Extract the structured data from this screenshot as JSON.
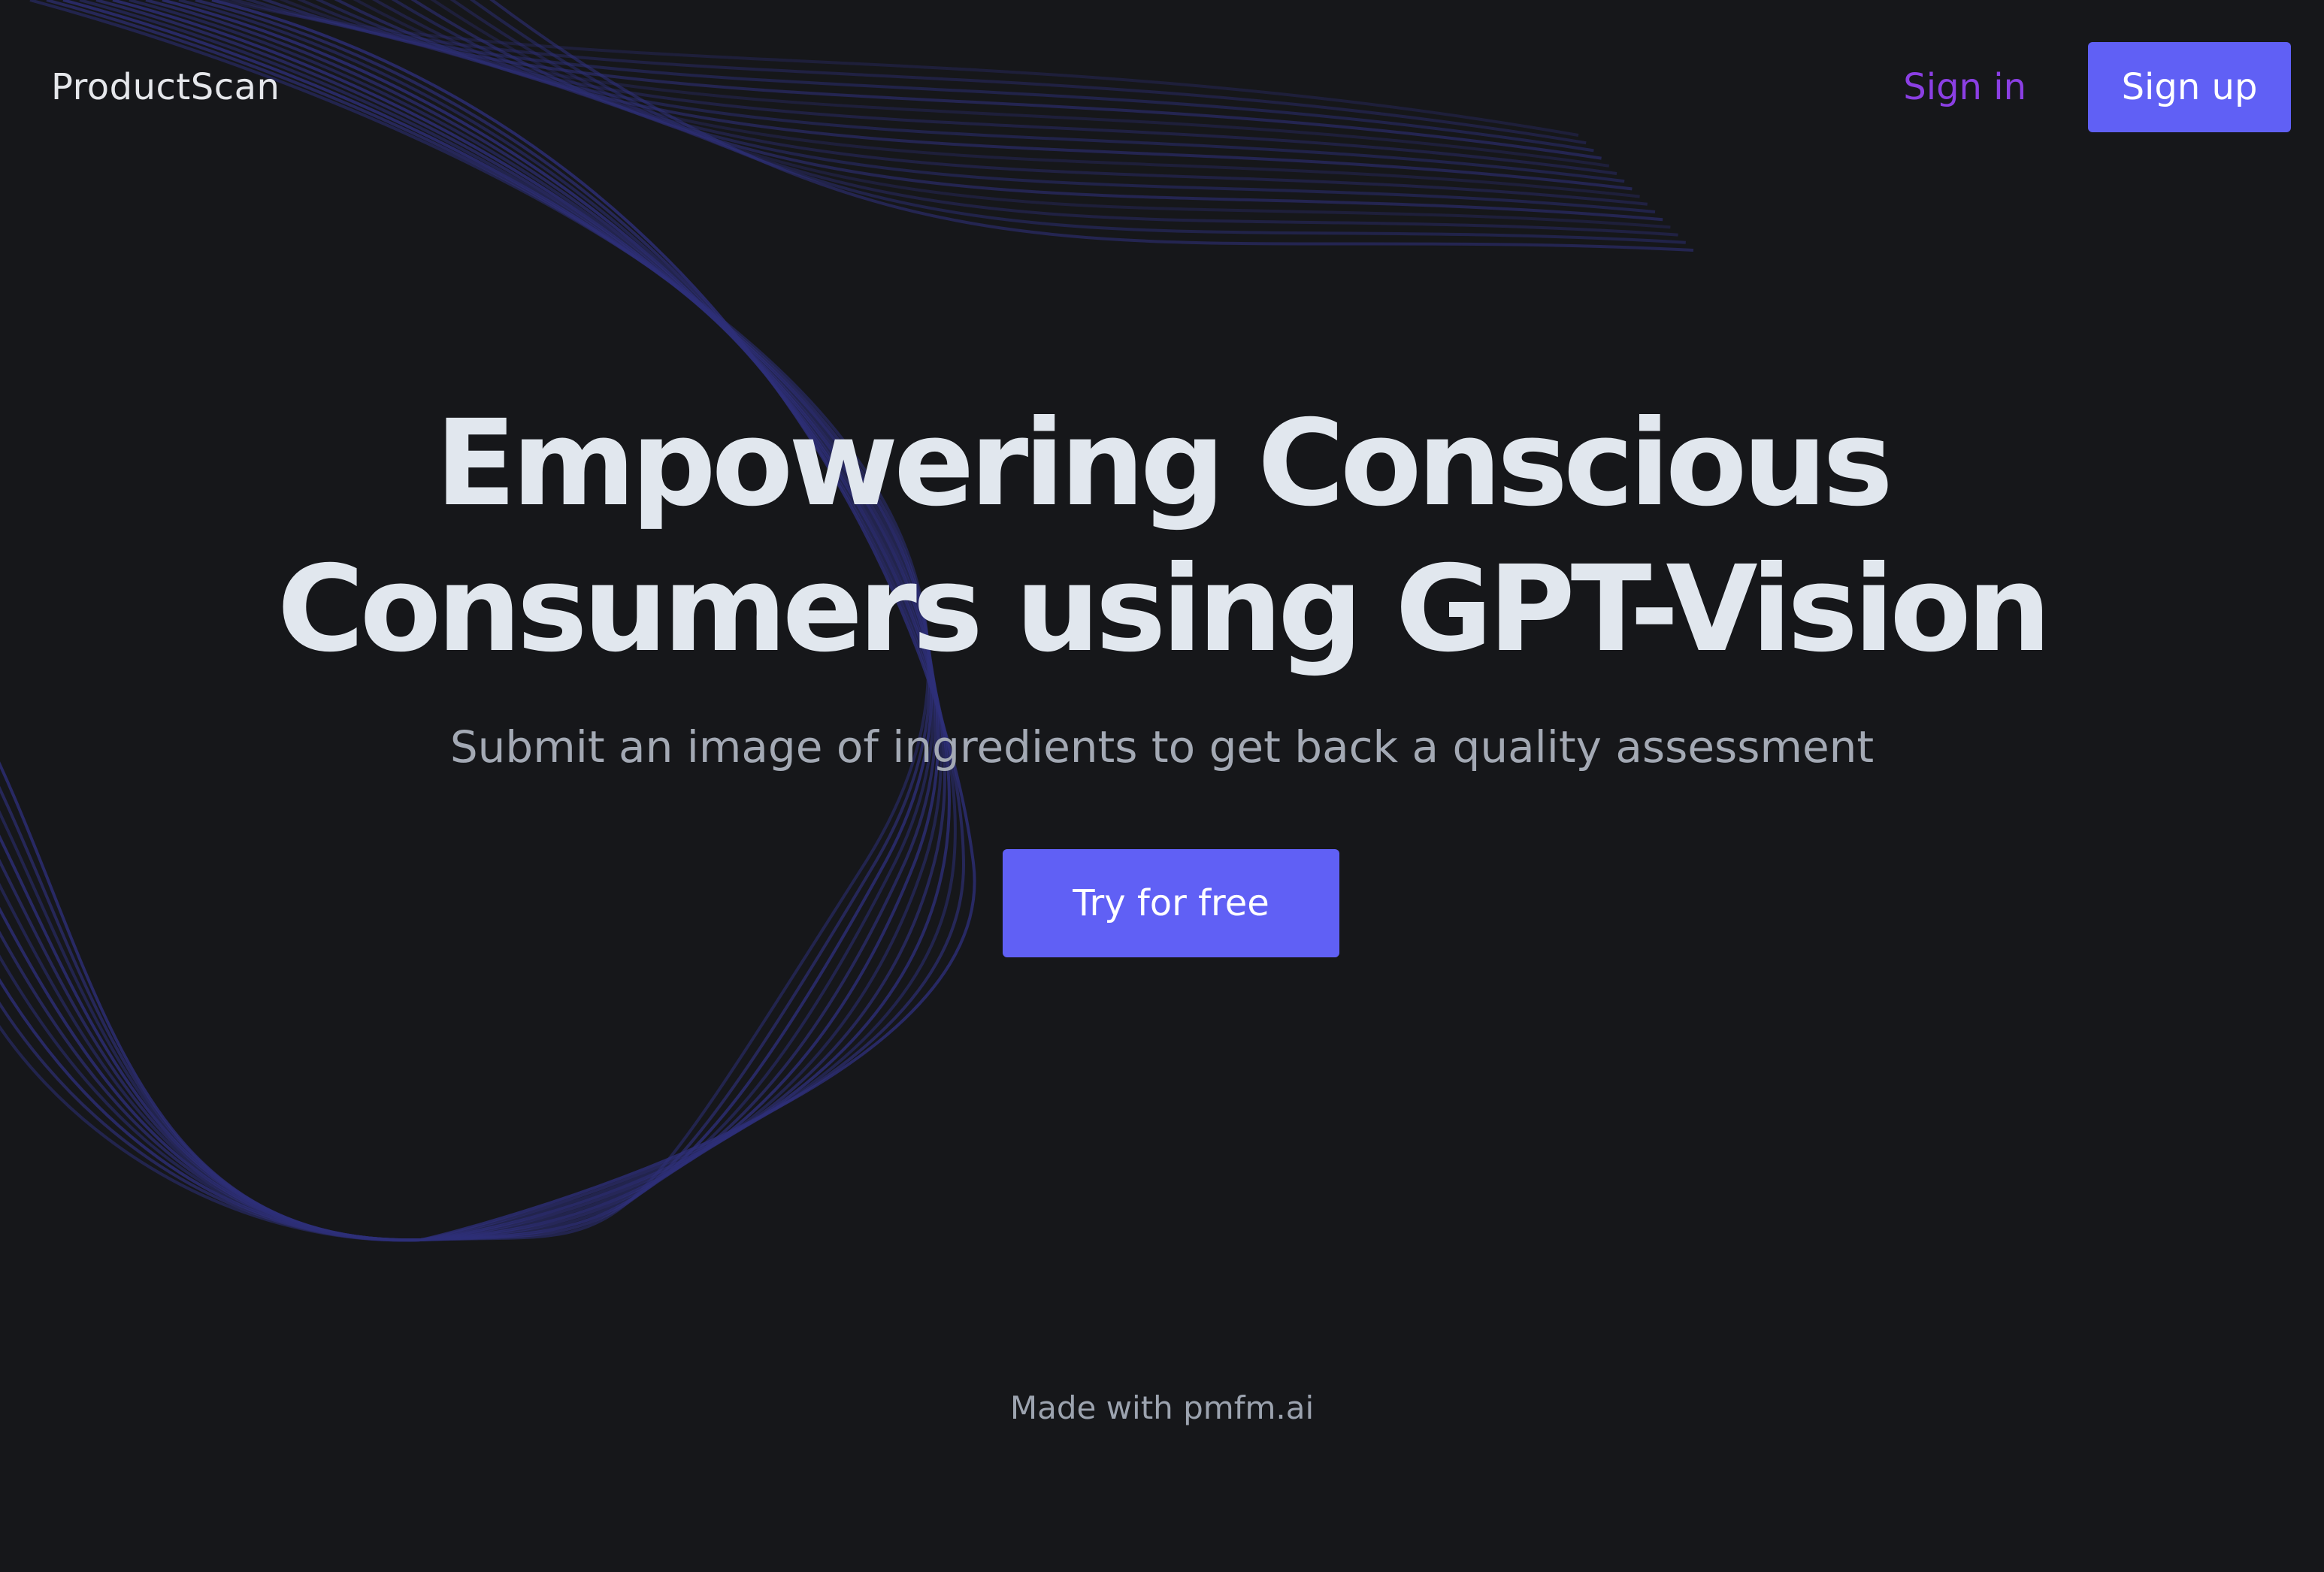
{
  "header": {
    "brand": "ProductScan",
    "sign_in_label": "Sign in",
    "sign_up_label": "Sign up"
  },
  "hero": {
    "title": "Empowering Conscious Consumers using GPT-Vision",
    "subtitle": "Submit an image of ingredients to get back a quality assessment",
    "cta_label": "Try for free"
  },
  "footer": {
    "text": "Made with pmfm.ai"
  },
  "colors": {
    "background": "#16171a",
    "accent": "#6060f5",
    "sign_in": "#8b3fe4",
    "wave": "#2e2f78"
  }
}
